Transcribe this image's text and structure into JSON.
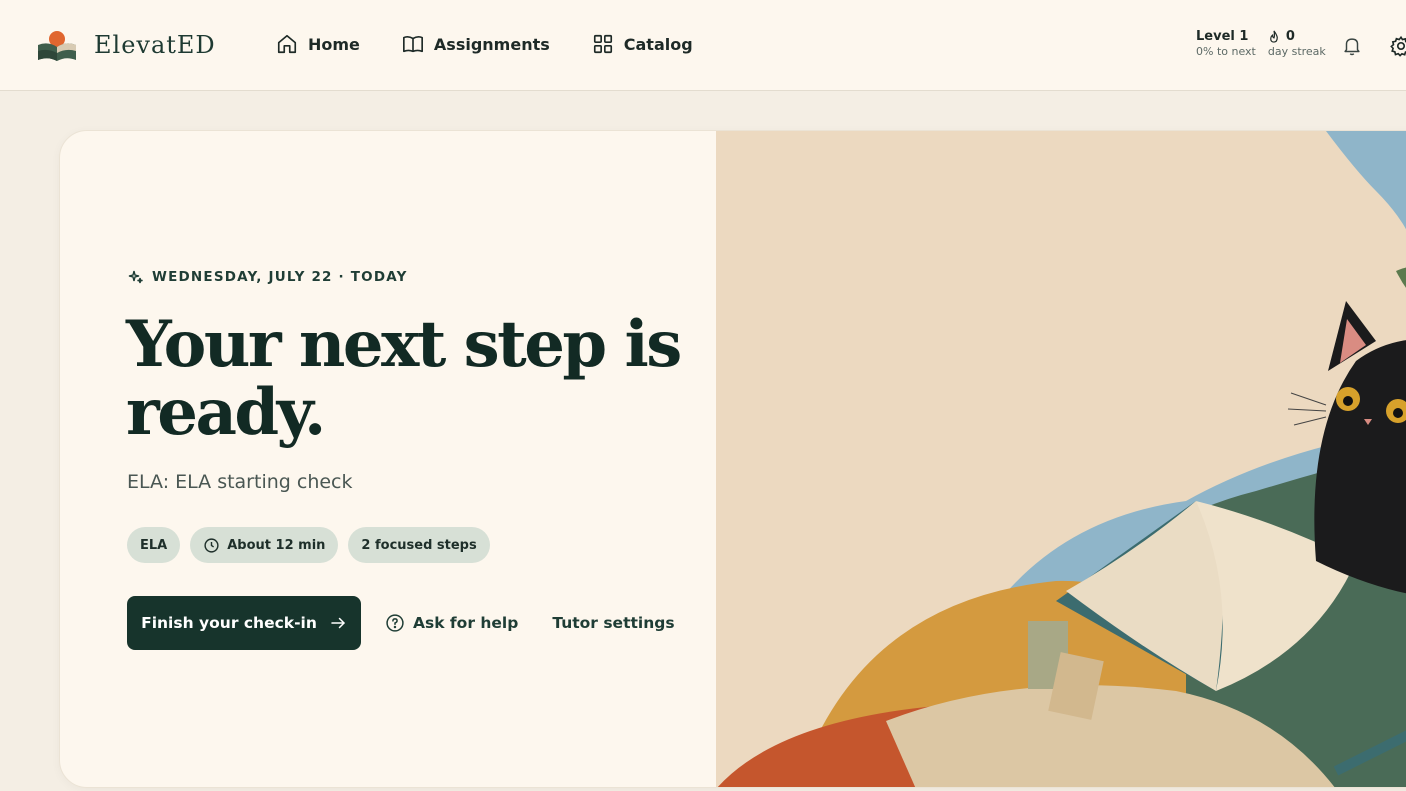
{
  "app": {
    "name": "ElevatED"
  },
  "nav": {
    "items": [
      {
        "label": "Home",
        "icon": "home-icon"
      },
      {
        "label": "Assignments",
        "icon": "book-icon"
      },
      {
        "label": "Catalog",
        "icon": "grid-icon"
      }
    ]
  },
  "stats": {
    "level_label": "Level 1",
    "level_sub": "0% to next",
    "streak_value": "0",
    "streak_sub": "day streak"
  },
  "header_icons": [
    "bell-icon",
    "gear-icon"
  ],
  "hero": {
    "date": "WEDNESDAY, JULY 22 · TODAY",
    "headline": "Your next step is ready.",
    "subtitle": "ELA: ELA starting check",
    "chips": [
      "ELA",
      "About 12 min",
      "2 focused steps"
    ],
    "primary_action": "Finish your check-in",
    "help_action": "Ask for help",
    "settings_action": "Tutor settings"
  },
  "colors": {
    "brand_dark": "#17342c",
    "chip_bg": "#d7e0d6",
    "page_bg": "#f4eee4",
    "card_bg": "#fdf7ee"
  }
}
